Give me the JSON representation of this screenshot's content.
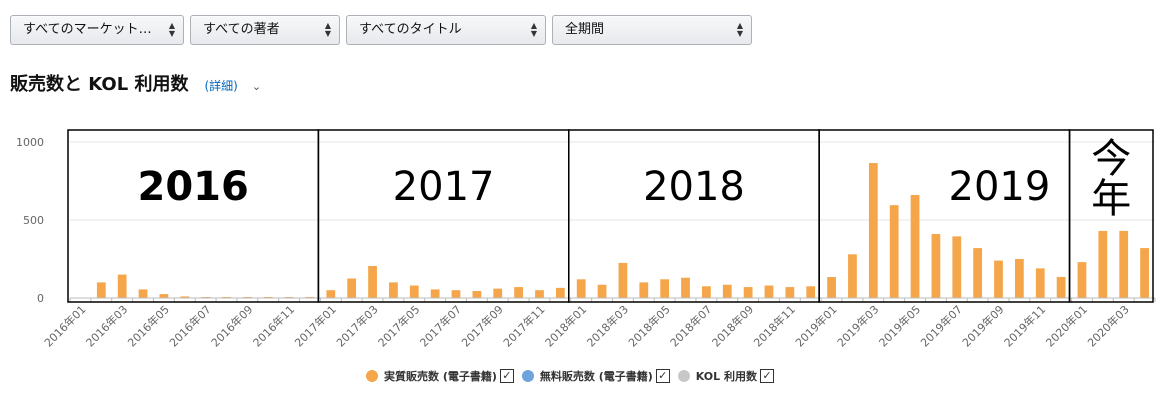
{
  "filters": [
    {
      "label": "すべてのマーケット…"
    },
    {
      "label": "すべての著者"
    },
    {
      "label": "すべてのタイトル"
    },
    {
      "label": "全期間"
    }
  ],
  "title": "販売数と KOL 利用数",
  "details_link": "(詳細)",
  "legend": [
    {
      "label": "実質販売数 (電子書籍)",
      "color": "#f5a54a",
      "checked": true
    },
    {
      "label": "無料販売数 (電子書籍)",
      "color": "#6fa3dc",
      "checked": true
    },
    {
      "label": "KOL 利用数",
      "color": "#c8c8c8",
      "checked": true
    }
  ],
  "chart_data": {
    "type": "bar",
    "ylim": [
      0,
      1000
    ],
    "yticks": [
      0,
      500,
      1000
    ],
    "bar_color": "#f5a54a",
    "categories": [
      "2016年01",
      "2016年02",
      "2016年03",
      "2016年04",
      "2016年05",
      "2016年06",
      "2016年07",
      "2016年08",
      "2016年09",
      "2016年10",
      "2016年11",
      "2016年12",
      "2017年01",
      "2017年02",
      "2017年03",
      "2017年04",
      "2017年05",
      "2017年06",
      "2017年07",
      "2017年08",
      "2017年09",
      "2017年10",
      "2017年11",
      "2017年12",
      "2018年01",
      "2018年02",
      "2018年03",
      "2018年04",
      "2018年05",
      "2018年06",
      "2018年07",
      "2018年08",
      "2018年09",
      "2018年10",
      "2018年11",
      "2018年12",
      "2019年01",
      "2019年02",
      "2019年03",
      "2019年04",
      "2019年05",
      "2019年06",
      "2019年07",
      "2019年08",
      "2019年09",
      "2019年10",
      "2019年11",
      "2019年12",
      "2020年01",
      "2020年02",
      "2020年03",
      "2020年04"
    ],
    "tick_labels": [
      "2016年01",
      "2016年03",
      "2016年05",
      "2016年07",
      "2016年09",
      "2016年11",
      "2017年01",
      "2017年03",
      "2017年05",
      "2017年07",
      "2017年09",
      "2017年11",
      "2018年01",
      "2018年03",
      "2018年05",
      "2018年07",
      "2018年09",
      "2018年11",
      "2019年01",
      "2019年03",
      "2019年05",
      "2019年07",
      "2019年09",
      "2019年11",
      "2020年01",
      "2020年03"
    ],
    "values": [
      0,
      100,
      150,
      55,
      25,
      10,
      5,
      3,
      3,
      3,
      3,
      3,
      50,
      125,
      205,
      100,
      80,
      55,
      50,
      45,
      60,
      70,
      50,
      65,
      120,
      85,
      225,
      100,
      120,
      130,
      75,
      85,
      70,
      80,
      70,
      75,
      135,
      280,
      865,
      595,
      660,
      410,
      395,
      320,
      240,
      250,
      190,
      135,
      230,
      430,
      430,
      320
    ],
    "annotations": [
      {
        "label": "2016",
        "from": 0,
        "to": 12
      },
      {
        "label": "2017",
        "from": 12,
        "to": 24
      },
      {
        "label": "2018",
        "from": 24,
        "to": 36
      },
      {
        "label": "2019",
        "from": 36,
        "to": 48
      },
      {
        "label": "今年",
        "from": 48,
        "to": 52
      }
    ]
  }
}
